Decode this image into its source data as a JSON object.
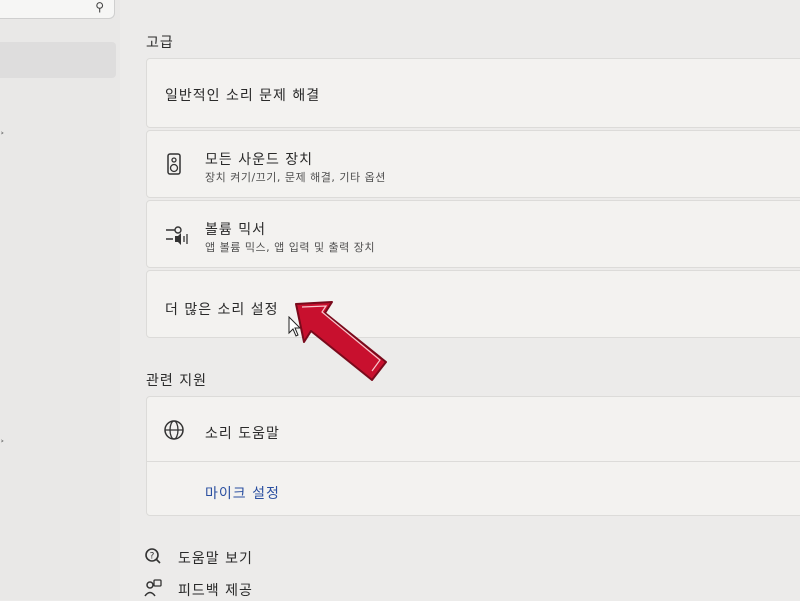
{
  "sidebar": {
    "search_icon": "search-icon"
  },
  "sections": {
    "advanced_title": "고급",
    "related_title": "관련 지원"
  },
  "advanced": {
    "troubleshoot": "일반적인 소리 문제 해결",
    "all_devices": {
      "title": "모든 사운드 장치",
      "subtitle": "장치 켜기/끄기, 문제 해결, 기타 옵션",
      "icon": "speaker-icon"
    },
    "volume_mixer": {
      "title": "볼륨 믹서",
      "subtitle": "앱 볼륨 믹스, 앱 입력 및 출력 장치",
      "icon": "mixer-icon"
    },
    "more_settings": "더 많은 소리 설정"
  },
  "related": {
    "sound_help": {
      "title": "소리 도움말",
      "icon": "globe-icon"
    },
    "mic_settings": "마이크 설정"
  },
  "footer": {
    "get_help": "도움말 보기",
    "feedback": "피드백 제공"
  },
  "annotation": {
    "arrow_color": "#c8102e"
  }
}
